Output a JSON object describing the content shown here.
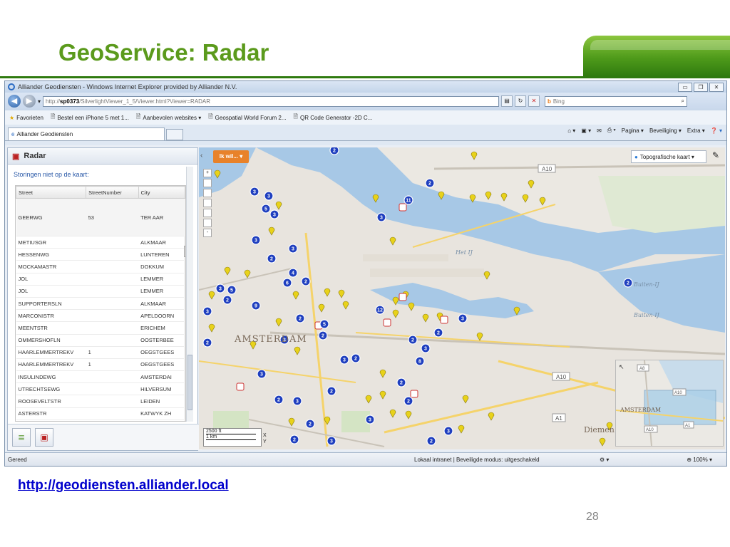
{
  "slide": {
    "title": "GeoService: Radar",
    "link": "http://geodiensten.alliander.local",
    "page_number": "28"
  },
  "browser": {
    "window_title": "Alliander Geodiensten - Windows Internet Explorer provided by Alliander N.V.",
    "url_prefix": "http://",
    "url_host": "sp0373",
    "url_path": "/SilverlightViewer_1_5/Viewer.html?Viewer=RADAR",
    "search_placeholder": "Bing",
    "favorites_label": "Favorieten",
    "favorites": [
      "Bestel een iPhone 5 met 1...",
      "Aanbevolen websites ▾",
      "Geospatial World Forum 2...",
      "QR Code Generator -2D C..."
    ],
    "tab_title": "Alliander Geodiensten",
    "commands": {
      "page": "Pagina ▾",
      "security": "Beveiliging ▾",
      "extra": "Extra ▾"
    },
    "status_left": "Gereed",
    "status_zone": "Lokaal intranet | Beveiligde modus: uitgeschakeld",
    "status_zoom": "100%"
  },
  "panel": {
    "title": "Radar",
    "subtitle": "Storingen niet op de kaart:",
    "columns": [
      "Street",
      "StreetNumber",
      "City"
    ],
    "rows": [
      {
        "street": "GEERWG",
        "number": "53",
        "city": "TER AAR"
      },
      {
        "street": "METIUSGR",
        "number": "",
        "city": "ALKMAAR"
      },
      {
        "street": "HESSENWG",
        "number": "",
        "city": "LUNTEREN"
      },
      {
        "street": "MOCKAMASTR",
        "number": "",
        "city": "DOKKUM"
      },
      {
        "street": "JOL",
        "number": "",
        "city": "LEMMER"
      },
      {
        "street": "JOL",
        "number": "",
        "city": "LEMMER"
      },
      {
        "street": "SUPPORTERSLN",
        "number": "",
        "city": "ALKMAAR"
      },
      {
        "street": "MARCONISTR",
        "number": "",
        "city": "APELDOORN"
      },
      {
        "street": "MEENTSTR",
        "number": "",
        "city": "ERICHEM"
      },
      {
        "street": "OMMERSHOFLN",
        "number": "",
        "city": "OOSTERBEE"
      },
      {
        "street": "HAARLEMMERTREKV",
        "number": "1",
        "city": "OEGSTGEES"
      },
      {
        "street": "HAARLEMMERTREKV",
        "number": "1",
        "city": "OEGSTGEES"
      },
      {
        "street": "INSULINDEWG",
        "number": "",
        "city": "AMSTERDAI"
      },
      {
        "street": "UTRECHTSEWG",
        "number": "",
        "city": "HILVERSUM"
      },
      {
        "street": "ROOSEVELTSTR",
        "number": "",
        "city": "LEIDEN"
      },
      {
        "street": "ASTERSTR",
        "number": "",
        "city": "KATWYK ZH"
      }
    ]
  },
  "map": {
    "action_button": "Ik wil... ▾",
    "basemap_label": "Topografische kaart ▾",
    "labels": {
      "city": "AMSTERDAM",
      "ij": "Het IJ",
      "buiten_ij_1": "Buiten-IJ",
      "buiten_ij_2": "Buiten-IJ",
      "diemen": "Diemen",
      "a10_top": "A10",
      "a10_mid": "A10",
      "a1": "A1"
    },
    "minimap_labels": {
      "a8": "A8",
      "a10_1": "A10",
      "a10_2": "A10",
      "a1": "A1",
      "city": "AMSTERDAM"
    },
    "scale_ft": "2500 ft",
    "scale_km": "1 km",
    "coord_x": "X",
    "coord_y": "Y",
    "marker_numbers": [
      "2",
      "3",
      "3",
      "5",
      "3",
      "2",
      "11",
      "3",
      "3",
      "2",
      "3",
      "4",
      "6",
      "2",
      "3",
      "5",
      "3",
      "9",
      "2",
      "2",
      "5",
      "2",
      "3",
      "2",
      "3",
      "2",
      "12",
      "8",
      "3",
      "2",
      "3",
      "2",
      "3",
      "2",
      "2",
      "2",
      "2",
      "3",
      "3",
      "2",
      "3",
      "2",
      "2",
      "2",
      "3",
      "2"
    ]
  },
  "colors": {
    "slide_title": "#5b9a1c",
    "marker_blue": "#1f3fbf",
    "marker_yellow": "#e8d21a",
    "water": "#a7c8e6",
    "accent_orange": "#e8822a"
  }
}
